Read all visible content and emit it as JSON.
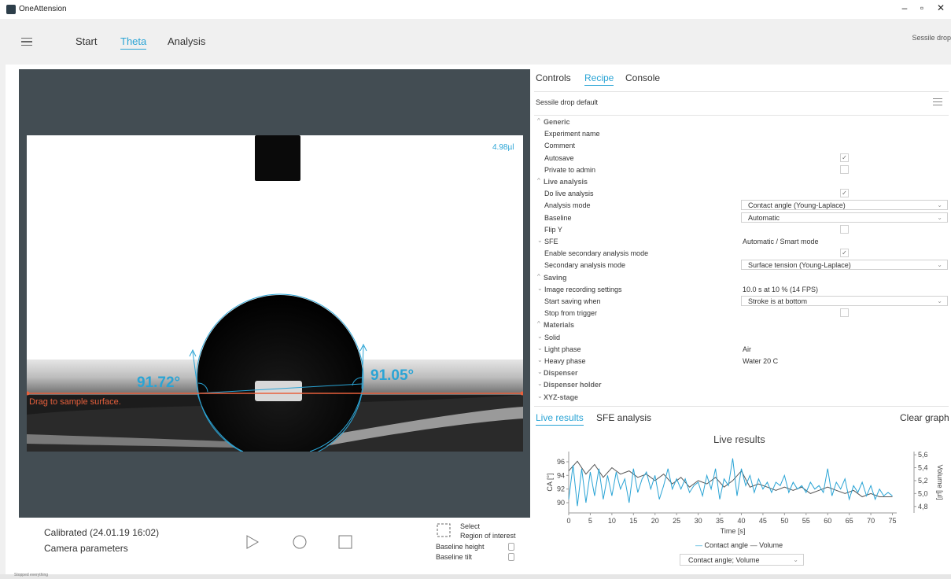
{
  "window": {
    "title": "OneAttension",
    "minimize": "–",
    "restore": "▫",
    "close": "✕"
  },
  "nav": {
    "tabs": [
      "Start",
      "Theta",
      "Analysis"
    ],
    "active": "Theta",
    "mode": "Sessile drop"
  },
  "camera": {
    "volume": "4.98µl",
    "angle_left": "91.72°",
    "angle_right": "91.05°",
    "hint": "Drag to sample surface.",
    "calibrated": "Calibrated (24.01.19 16:02)",
    "camera_params": "Camera parameters",
    "select_roi_1": "Select",
    "select_roi_2": "Region of interest",
    "baseline_height": "Baseline height",
    "baseline_tilt": "Baseline tilt"
  },
  "panel_tabs": {
    "items": [
      "Controls",
      "Recipe",
      "Console"
    ],
    "active": "Recipe"
  },
  "recipe": {
    "title": "Sessile drop default",
    "rows": [
      {
        "label": "Generic",
        "section": true,
        "chev": "^"
      },
      {
        "label": "Experiment name"
      },
      {
        "label": "Comment"
      },
      {
        "label": "Autosave",
        "checkbox": true,
        "checked": true
      },
      {
        "label": "Private to admin",
        "checkbox": true,
        "checked": false
      },
      {
        "label": "Live analysis",
        "section": true,
        "chev": "^"
      },
      {
        "label": "Do live analysis",
        "checkbox": true,
        "checked": true
      },
      {
        "label": "Analysis mode",
        "select": "Contact angle (Young-Laplace)"
      },
      {
        "label": "Baseline",
        "select": "Automatic"
      },
      {
        "label": "Flip Y",
        "checkbox": true,
        "checked": false
      },
      {
        "label": "SFE",
        "chev": "v",
        "value": "Automatic / Smart mode"
      },
      {
        "label": "Enable secondary analysis mode",
        "checkbox": true,
        "checked": true
      },
      {
        "label": "Secondary analysis mode",
        "select": "Surface tension (Young-Laplace)"
      },
      {
        "label": "Saving",
        "section": true,
        "chev": "^"
      },
      {
        "label": "Image recording settings",
        "chev": "v",
        "value": "10.0 s at 10 % (14 FPS)"
      },
      {
        "label": "Start saving when",
        "select": "Stroke is at bottom"
      },
      {
        "label": "Stop from trigger",
        "checkbox": true,
        "checked": false
      },
      {
        "label": "Materials",
        "section": true,
        "chev": "^"
      },
      {
        "label": "Solid",
        "chev": "v"
      },
      {
        "label": "Light phase",
        "chev": "v",
        "value": "Air"
      },
      {
        "label": "Heavy phase",
        "chev": "v",
        "value": "Water 20 C"
      },
      {
        "label": "Dispenser",
        "section": true,
        "chev": "v"
      },
      {
        "label": "Dispenser holder",
        "section": true,
        "chev": "v"
      },
      {
        "label": "XYZ-stage",
        "section": true,
        "chev": "v"
      }
    ]
  },
  "results_tabs": {
    "items": [
      "Live results",
      "SFE analysis"
    ],
    "active": "Live results",
    "clear": "Clear graph"
  },
  "chart_data": {
    "type": "line",
    "title": "Live results",
    "xlabel": "Time [s]",
    "ylabel": "CA [°]",
    "y2label": "Volume [µl]",
    "xlim": [
      0,
      76
    ],
    "ylim": [
      88.5,
      97.5
    ],
    "y2lim": [
      4.7,
      5.65
    ],
    "xticks": [
      0,
      5,
      10,
      15,
      20,
      25,
      30,
      35,
      40,
      45,
      50,
      55,
      60,
      65,
      70,
      75
    ],
    "yticks": [
      90,
      92,
      94,
      96
    ],
    "y2ticks": [
      "4,8",
      "5,0",
      "5,2",
      "5,4",
      "5,6"
    ],
    "legend": [
      "Contact angle",
      "Volume"
    ],
    "series": [
      {
        "name": "Contact angle",
        "color": "#2aa4d5",
        "x": [
          0,
          1,
          2,
          3,
          4,
          5,
          6,
          7,
          8,
          9,
          10,
          11,
          12,
          13,
          14,
          15,
          16,
          17,
          18,
          19,
          20,
          21,
          22,
          23,
          24,
          25,
          26,
          27,
          28,
          29,
          30,
          31,
          32,
          33,
          34,
          35,
          36,
          37,
          38,
          39,
          40,
          41,
          42,
          43,
          44,
          45,
          46,
          47,
          48,
          49,
          50,
          51,
          52,
          53,
          54,
          55,
          56,
          57,
          58,
          59,
          60,
          61,
          62,
          63,
          64,
          65,
          66,
          67,
          68,
          69,
          70,
          71,
          72,
          73,
          74,
          75
        ],
        "values": [
          90.5,
          95.5,
          89.5,
          95,
          90,
          94.5,
          91,
          95,
          90.5,
          94,
          91,
          94.5,
          92,
          93.5,
          90,
          95,
          91.5,
          93.5,
          94.5,
          92,
          94,
          90.5,
          92.5,
          95,
          92,
          93.5,
          92,
          93.5,
          91.5,
          92.5,
          93,
          91,
          94,
          92,
          95,
          90.5,
          93.5,
          92.5,
          96.5,
          91,
          95,
          92.5,
          94,
          91.5,
          93.5,
          92,
          93,
          91.5,
          93,
          92.5,
          94,
          91.5,
          93,
          92,
          92.5,
          91.5,
          93,
          92,
          92.5,
          91.5,
          95,
          91,
          93,
          92,
          93.5,
          90.5,
          92.5,
          91.5,
          93,
          91,
          92.5,
          90.5,
          92,
          91,
          91.5,
          91
        ]
      },
      {
        "name": "Volume",
        "color": "#555555",
        "x": [
          0,
          2,
          4,
          6,
          8,
          10,
          12,
          14,
          16,
          18,
          20,
          22,
          24,
          26,
          28,
          30,
          32,
          34,
          36,
          38,
          40,
          42,
          44,
          46,
          48,
          50,
          52,
          54,
          56,
          58,
          60,
          62,
          64,
          66,
          68,
          70,
          72,
          74,
          75
        ],
        "values": [
          5.35,
          5.5,
          5.3,
          5.45,
          5.25,
          5.4,
          5.3,
          5.35,
          5.25,
          5.3,
          5.2,
          5.3,
          5.15,
          5.25,
          5.1,
          5.2,
          5.15,
          5.25,
          5.1,
          5.2,
          5.35,
          5.1,
          5.15,
          5.1,
          5.05,
          5.1,
          5.05,
          5.1,
          5.0,
          5.05,
          5.1,
          5.05,
          5.0,
          5.05,
          4.95,
          5.0,
          4.95,
          4.95,
          4.95
        ]
      }
    ]
  },
  "chart_select": "Contact angle; Volume",
  "status": "Stopped everything"
}
